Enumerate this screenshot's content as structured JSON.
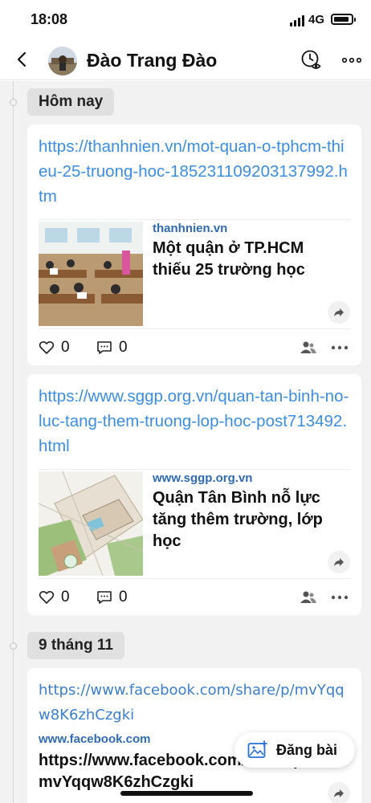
{
  "status_bar": {
    "time": "18:08",
    "network": "4G"
  },
  "header": {
    "title": "Đào Trang Đào"
  },
  "feed": [
    {
      "date_label": "Hôm nay",
      "posts": [
        {
          "url": "https://thanhnien.vn/mot-quan-o-tphcm-thieu-25-truong-hoc-185231109203137992.htm",
          "preview_domain": "thanhnien.vn",
          "preview_title": "Một quận ở TP.HCM thiếu 25 trường học",
          "likes": "0",
          "comments": "0"
        },
        {
          "url": "https://www.sggp.org.vn/quan-tan-binh-no-luc-tang-them-truong-lop-hoc-post713492.html",
          "preview_domain": "www.sggp.org.vn",
          "preview_title": "Quận Tân Bình nỗ lực tăng thêm trường, lớp học",
          "likes": "0",
          "comments": "0"
        }
      ]
    },
    {
      "date_label": "9 tháng 11",
      "posts": [
        {
          "url": "https://www.facebook.com/share/p/mvYqqw8K6zhCzgki",
          "preview_domain": "www.facebook.com",
          "preview_title": "https://www.facebook.com/share/p/mvYqqw8K6zhCzgki"
        }
      ]
    }
  ],
  "post_button": {
    "label": "Đăng bài"
  },
  "colors": {
    "link": "#3a8ee6",
    "domain": "#2f6bb4",
    "feed_bg": "#f2f2f2",
    "chip_bg": "#e0e0e0"
  }
}
